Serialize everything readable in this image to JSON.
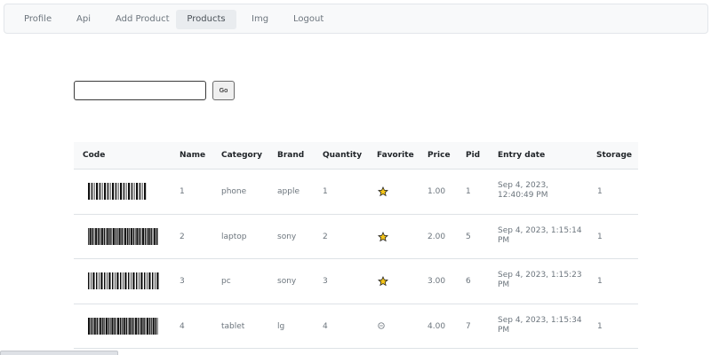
{
  "nav": {
    "items": [
      {
        "label": "Profile",
        "active": false
      },
      {
        "label": "Api",
        "active": false
      },
      {
        "label": "Add Product",
        "active": false
      },
      {
        "label": "Products",
        "active": true
      },
      {
        "label": "Img",
        "active": false
      },
      {
        "label": "Logout",
        "active": false
      }
    ]
  },
  "search": {
    "value": "",
    "placeholder": "",
    "button_label": "Go"
  },
  "table": {
    "columns": [
      "Code",
      "Name",
      "Category",
      "Brand",
      "Quantity",
      "Favorite",
      "Price",
      "Pid",
      "Entry date",
      "Storage"
    ],
    "rows": [
      {
        "code_icon": "barcode-icon",
        "name": "1",
        "category": "phone",
        "brand": "apple",
        "quantity": "1",
        "favorite": true,
        "favorite_icon": "star-icon",
        "price": "1.00",
        "pid": "1",
        "entry_date": "Sep 4, 2023, 12:40:49 PM",
        "storage": "1"
      },
      {
        "code_icon": "barcode-icon",
        "name": "2",
        "category": "laptop",
        "brand": "sony",
        "quantity": "2",
        "favorite": true,
        "favorite_icon": "star-icon",
        "price": "2.00",
        "pid": "5",
        "entry_date": "Sep 4, 2023, 1:15:14 PM",
        "storage": "1"
      },
      {
        "code_icon": "barcode-icon",
        "name": "3",
        "category": "pc",
        "brand": "sony",
        "quantity": "3",
        "favorite": true,
        "favorite_icon": "star-icon",
        "price": "3.00",
        "pid": "6",
        "entry_date": "Sep 4, 2023, 1:15:23 PM",
        "storage": "1"
      },
      {
        "code_icon": "barcode-icon",
        "name": "4",
        "category": "tablet",
        "brand": "lg",
        "quantity": "4",
        "favorite": false,
        "favorite_icon": "minus-circle-icon",
        "price": "4.00",
        "pid": "7",
        "entry_date": "Sep 4, 2023, 1:15:34 PM",
        "storage": "1"
      }
    ]
  },
  "colors": {
    "navbar_bg": "#f8f9fa",
    "active_tab_bg": "#e9ecef",
    "header_bg": "#f8f9fa",
    "star_fill": "#f5c518"
  }
}
